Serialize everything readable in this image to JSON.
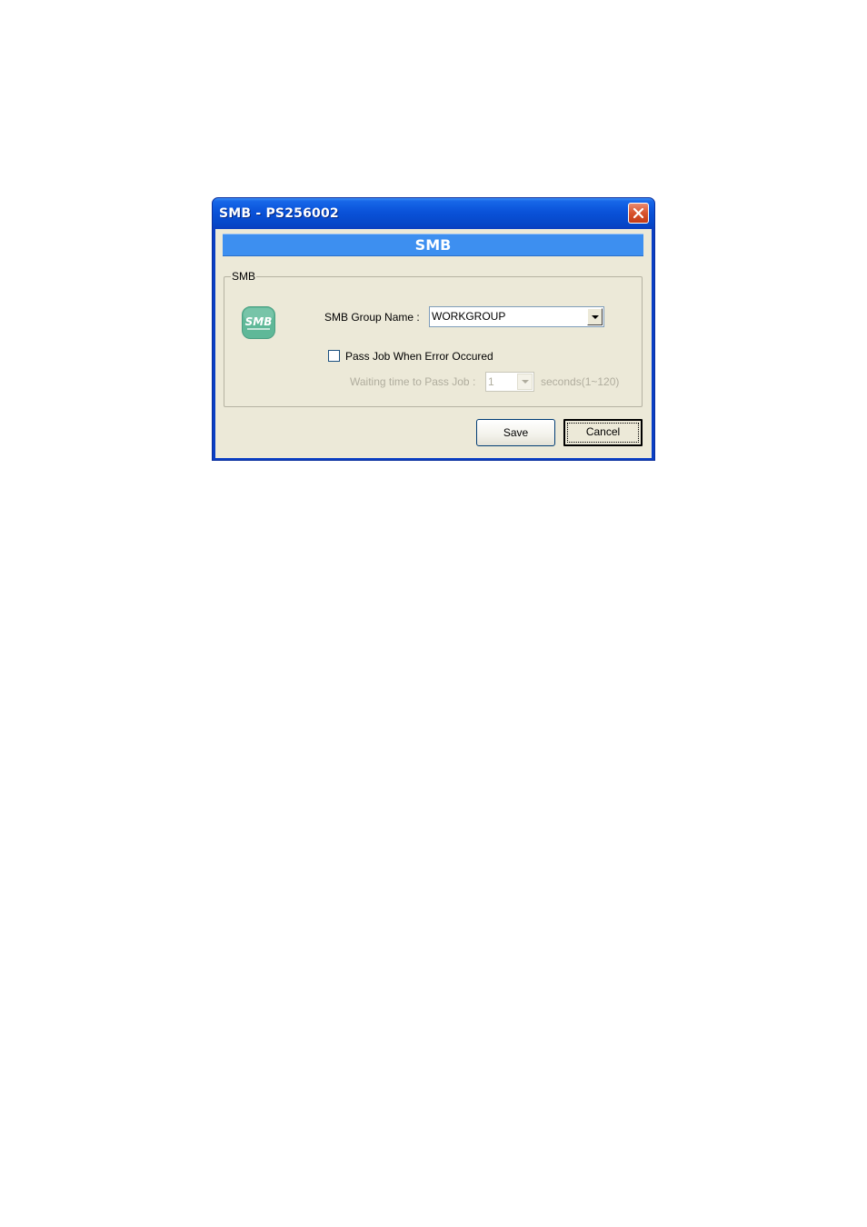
{
  "window": {
    "title": "SMB - PS256002"
  },
  "banner": {
    "title": "SMB"
  },
  "group": {
    "legend": "SMB",
    "logo_text": "SMB",
    "group_name_label": "SMB Group Name :",
    "group_name_value": "WORKGROUP",
    "pass_job_label": "Pass Job When Error Occured",
    "pass_job_checked": false,
    "waiting_label": "Waiting time to Pass Job :",
    "waiting_value": "1",
    "waiting_unit": "seconds(1~120)"
  },
  "buttons": {
    "save_label": "Save",
    "cancel_label": "Cancel"
  },
  "icons": {
    "close": "close-icon",
    "logo": "smb-logo-icon",
    "dropdown": "chevron-down-icon"
  },
  "colors": {
    "titlebar": "#0a52d9",
    "banner": "#3d8ff0",
    "dialog_bg": "#ece9d8",
    "logo": "#5fb898",
    "close_button": "#d8532d"
  }
}
